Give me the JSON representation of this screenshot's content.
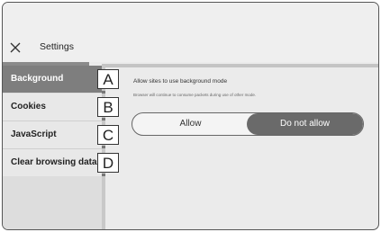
{
  "header": {
    "title": "Settings",
    "close_icon": "close-icon"
  },
  "sidebar": {
    "items": [
      {
        "label": "Background",
        "active": true
      },
      {
        "label": "Cookies",
        "active": false
      },
      {
        "label": "JavaScript",
        "active": false
      },
      {
        "label": "Clear browsing data",
        "active": false
      }
    ]
  },
  "callouts": [
    "A",
    "B",
    "C",
    "D"
  ],
  "content": {
    "heading": "Allow sites to use background mode",
    "description": "Browser will continue to consume packets during use of other mode.",
    "options": {
      "allow": "Allow",
      "deny": "Do not allow",
      "selected": "Do not allow"
    }
  },
  "colors": {
    "active_item": "#7e7e7e",
    "toggle_selected": "#6a6a6a"
  }
}
